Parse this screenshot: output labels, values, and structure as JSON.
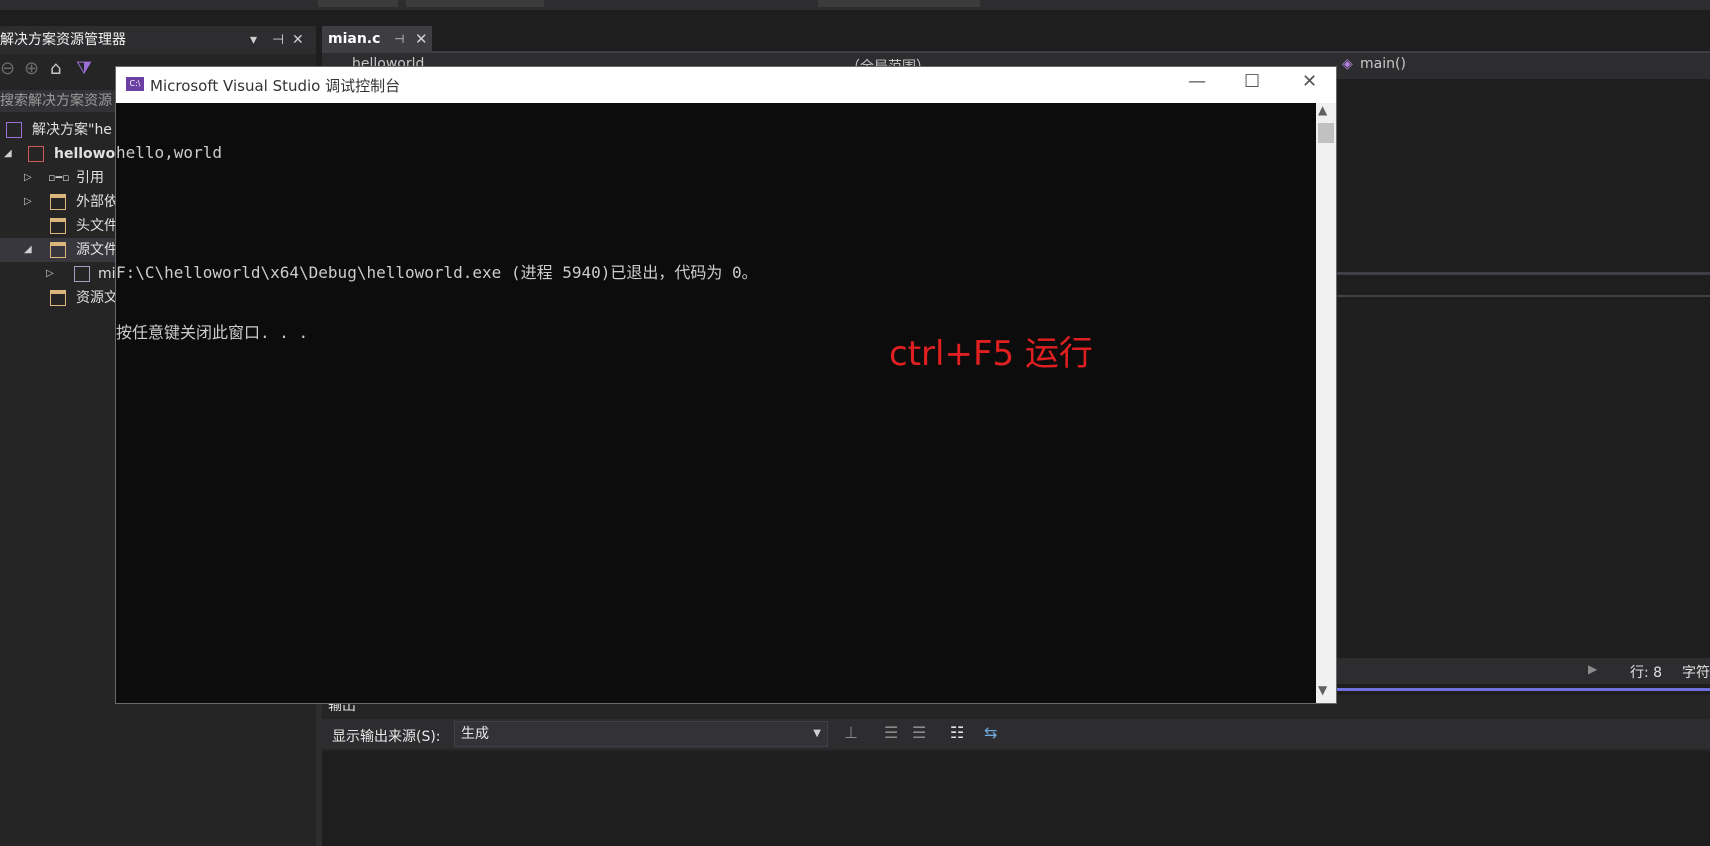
{
  "solution_explorer": {
    "title": "解决方案资源管理器",
    "pin_glyph": "▾",
    "pin2": "⊣",
    "close": "✕",
    "search_placeholder": "搜索解决方案资源",
    "tree": [
      {
        "label": "解决方案\"he"
      },
      {
        "label": "hellowo"
      },
      {
        "label": "引用"
      },
      {
        "label": "外部依"
      },
      {
        "label": "头文件"
      },
      {
        "label": "源文件"
      },
      {
        "label": "mi"
      },
      {
        "label": "资源文"
      }
    ]
  },
  "editor": {
    "tab_label": "mian.c",
    "tab_pin": "⊣",
    "tab_close": "✕",
    "nav_project": "helloworld",
    "nav_scope": "（全局范围）",
    "nav_function": "main()"
  },
  "status": {
    "line": "行: 8",
    "char": "字符"
  },
  "output": {
    "title": "输出",
    "source_label": "显示输出来源(S):",
    "source_value": "生成"
  },
  "console": {
    "title": "Microsoft Visual Studio 调试控制台",
    "app_icon": "C:\\",
    "minimize": "—",
    "maximize": "☐",
    "close": "✕",
    "lines": [
      "hello,world",
      "",
      "F:\\C\\helloworld\\x64\\Debug\\helloworld.exe (进程 5940)已退出，代码为 0。",
      "按任意键关闭此窗口. . ."
    ]
  },
  "annotation": "ctrl+F5 运行",
  "colors": {
    "ide_background": "#1e1e1e",
    "panel": "#252526",
    "console_background": "#0c0c0c",
    "annotation_red": "#e02020",
    "status_accent": "#6f6fe0"
  }
}
